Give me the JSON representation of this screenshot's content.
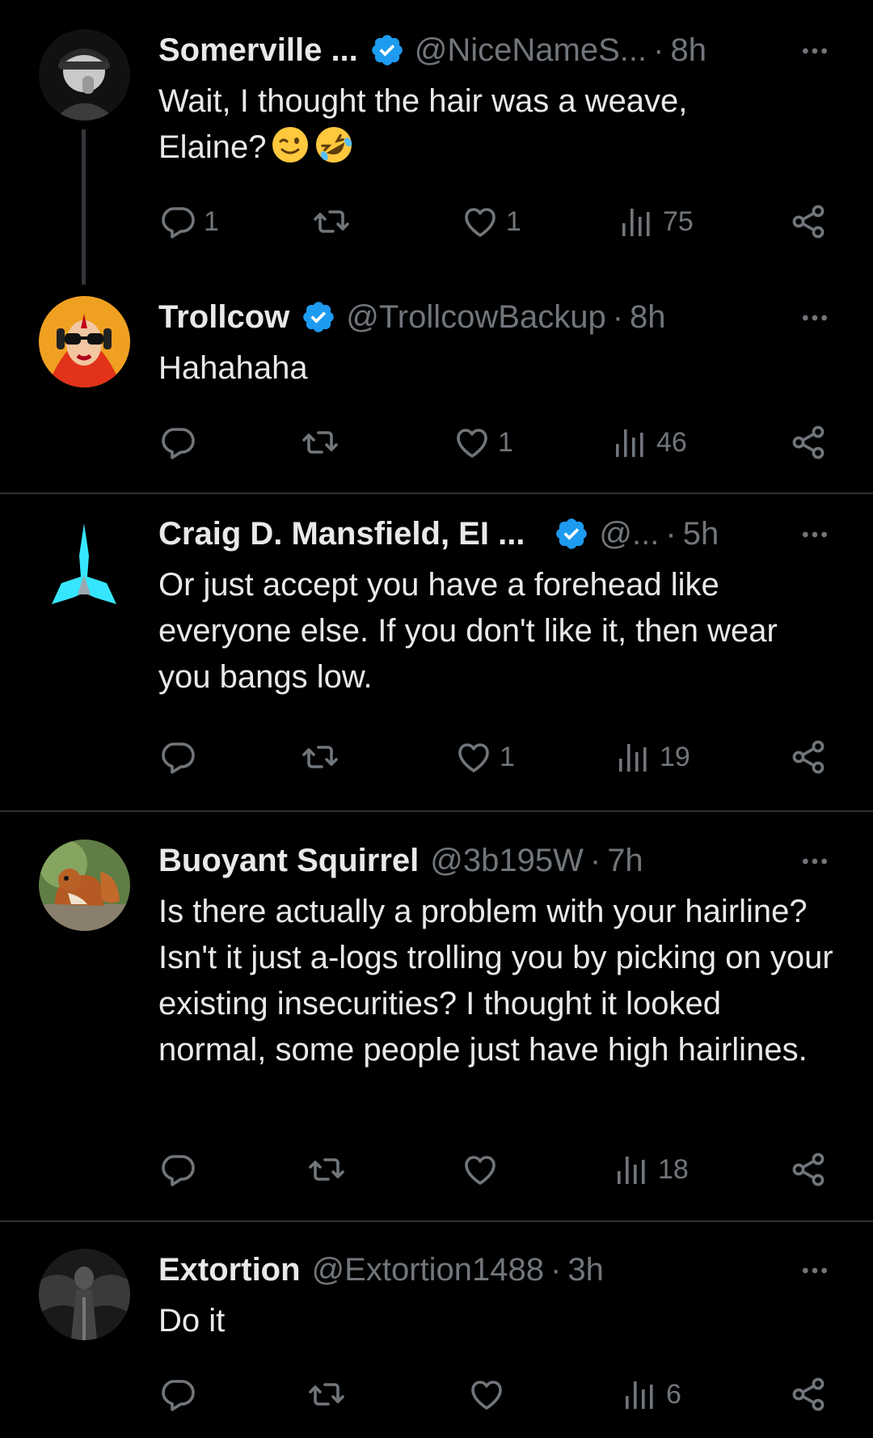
{
  "tweets": [
    {
      "name": "Somerville ...",
      "handle": "@NiceNameS...",
      "dot": "·",
      "time": "8h",
      "text_lines": [
        "Wait, I thought the hair was a weave,",
        "Elaine?"
      ],
      "emojis": [
        "winking-face",
        "rolling-on-floor-laughing"
      ],
      "replies": "1",
      "retweets": "",
      "likes": "1",
      "views": "75"
    },
    {
      "name": "Trollcow",
      "handle": "@TrollcowBackup",
      "dot": "·",
      "time": "8h",
      "text": "Hahahaha",
      "replies": "",
      "retweets": "",
      "likes": "1",
      "views": "46"
    },
    {
      "name": "Craig D. Mansfield, EI ...",
      "handle": "@...",
      "dot": "·",
      "time": "5h",
      "text": "Or just accept you have a forehead like everyone else. If you don't like it, then wear you bangs low.",
      "replies": "",
      "retweets": "",
      "likes": "1",
      "views": "19"
    },
    {
      "name": "Buoyant Squirrel",
      "handle": "@3b195W",
      "dot": "·",
      "time": "7h",
      "text": "Is there actually a problem with your hairline? Isn't it just a-logs trolling you by picking on your existing insecurities? I thought it looked normal, some people just have high hairlines.",
      "replies": "",
      "retweets": "",
      "likes": "",
      "views": "18"
    },
    {
      "name": "Extortion",
      "handle": "@Extortion1488",
      "dot": "·",
      "time": "3h",
      "text": "Do it",
      "replies": "",
      "retweets": "",
      "likes": "",
      "views": "6"
    }
  ],
  "colors": {
    "background": "#000000",
    "text": "#e7e9ea",
    "secondary": "#71767b",
    "verified": "#1d9bf0",
    "divider": "#2f3336"
  }
}
